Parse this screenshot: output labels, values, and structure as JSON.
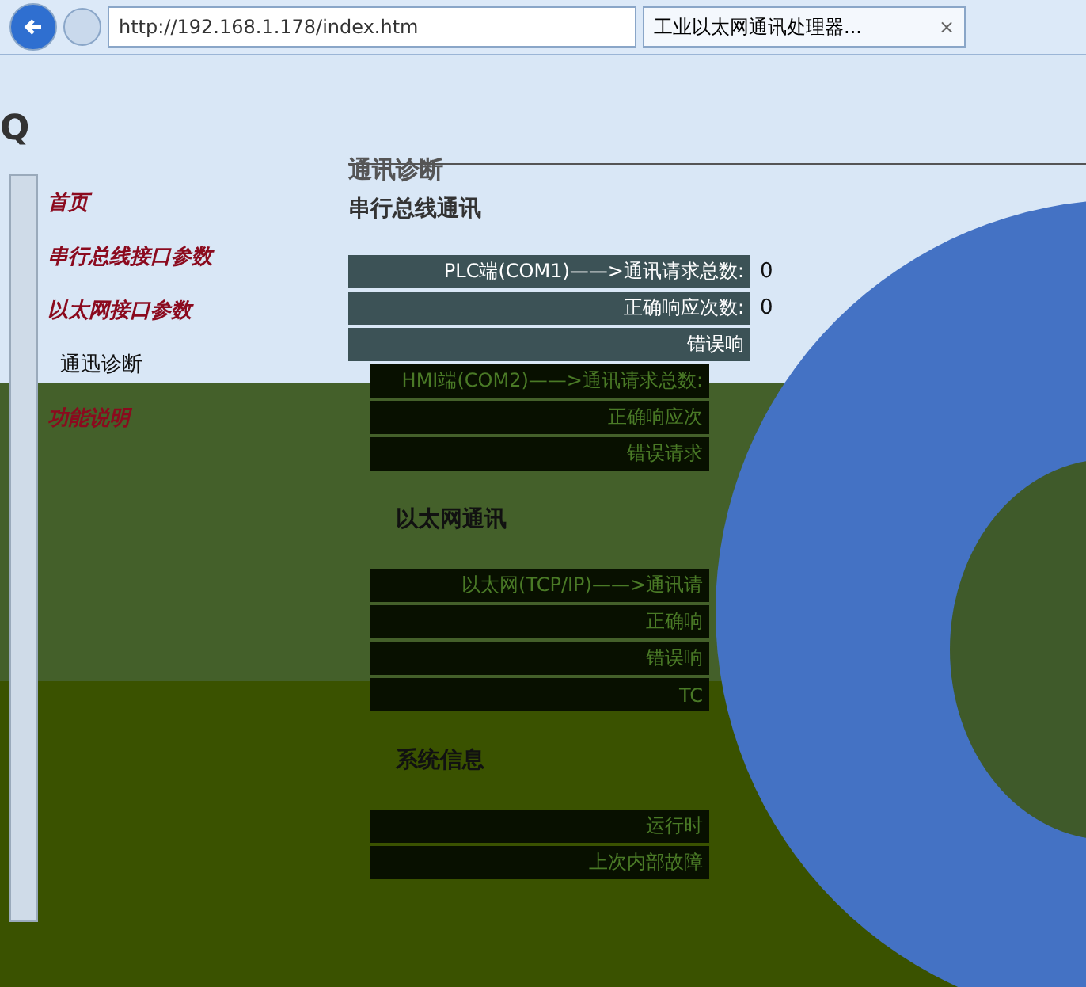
{
  "browser": {
    "url": "http://192.168.1.178/index.htm",
    "tab_title": "工业以太网通讯处理器...",
    "tab_close": "×"
  },
  "logo_letter": "Q",
  "sidebar": {
    "items": [
      {
        "label": "首页",
        "selected": false
      },
      {
        "label": "串行总线接口参数",
        "selected": false
      },
      {
        "label": "以太网接口参数",
        "selected": false
      },
      {
        "label": "通迅诊断",
        "selected": true
      },
      {
        "label": "功能说明",
        "selected": false
      }
    ]
  },
  "page_title": "通讯诊断",
  "sections": [
    {
      "title": "串行总线通讯",
      "rows": [
        {
          "label": "PLC端(COM1)——>通讯请求总数:",
          "value": "0"
        },
        {
          "label": "正确响应次数:",
          "value": "0"
        },
        {
          "label": "错误响"
        },
        {
          "label": "HMI端(COM2)——>通讯请求总数:"
        },
        {
          "label": "正确响应次"
        },
        {
          "label": "错误请求"
        }
      ]
    },
    {
      "title": "以太网通讯",
      "rows": [
        {
          "label": "以太网(TCP/IP)——>通讯请"
        },
        {
          "label": "正确响"
        },
        {
          "label": "错误响"
        },
        {
          "label": "TC"
        }
      ]
    },
    {
      "title": "系统信息",
      "rows": [
        {
          "label": "运行时"
        },
        {
          "label": "上次内部故障"
        }
      ]
    }
  ]
}
